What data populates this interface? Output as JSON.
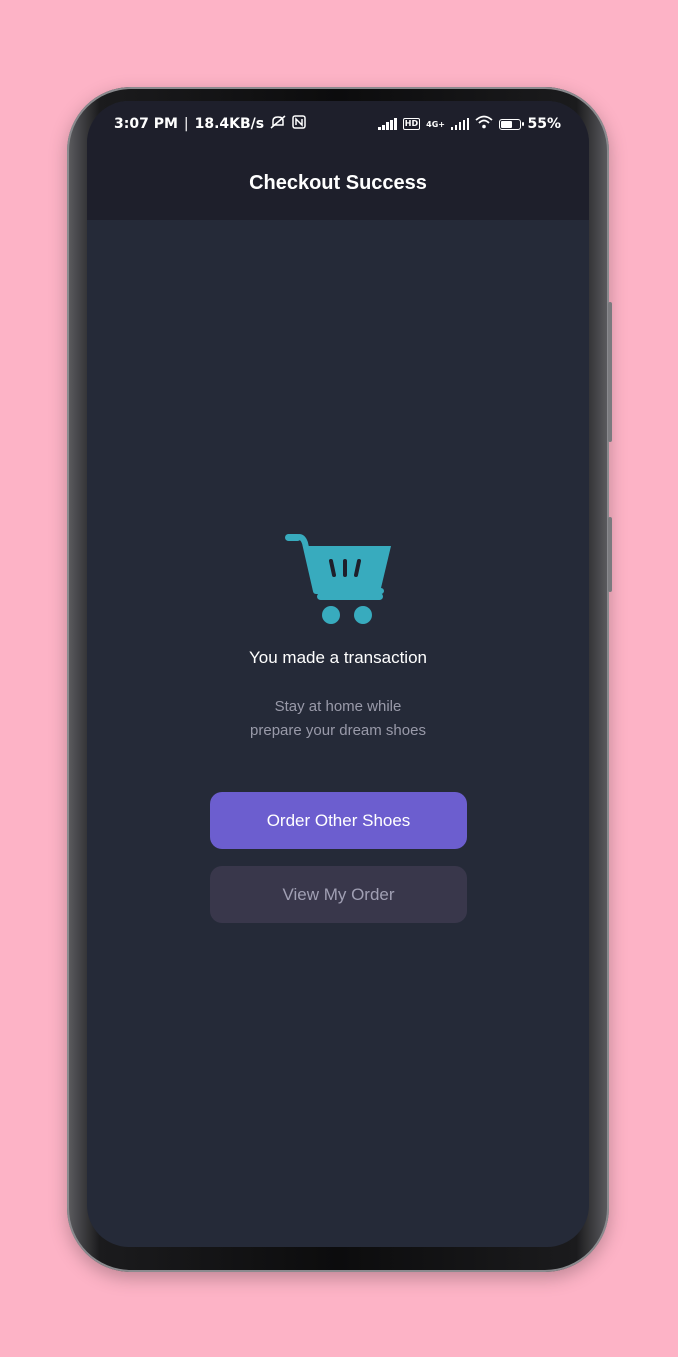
{
  "status_bar": {
    "time": "3:07 PM",
    "separator": "|",
    "speed": "18.4KB/s",
    "battery": "55%",
    "network": "4G+"
  },
  "header": {
    "title": "Checkout Success"
  },
  "success": {
    "icon": "shopping-cart-icon",
    "title": "You made a transaction",
    "subtitle_line1": "Stay at home while",
    "subtitle_line2": "prepare your dream shoes"
  },
  "buttons": {
    "primary_label": "Order Other Shoes",
    "secondary_label": "View My Order"
  },
  "colors": {
    "background": "#252a38",
    "header": "#1e1f2b",
    "accent": "#6c5ecf",
    "cart": "#38abbe",
    "secondary_button": "#39374b"
  }
}
